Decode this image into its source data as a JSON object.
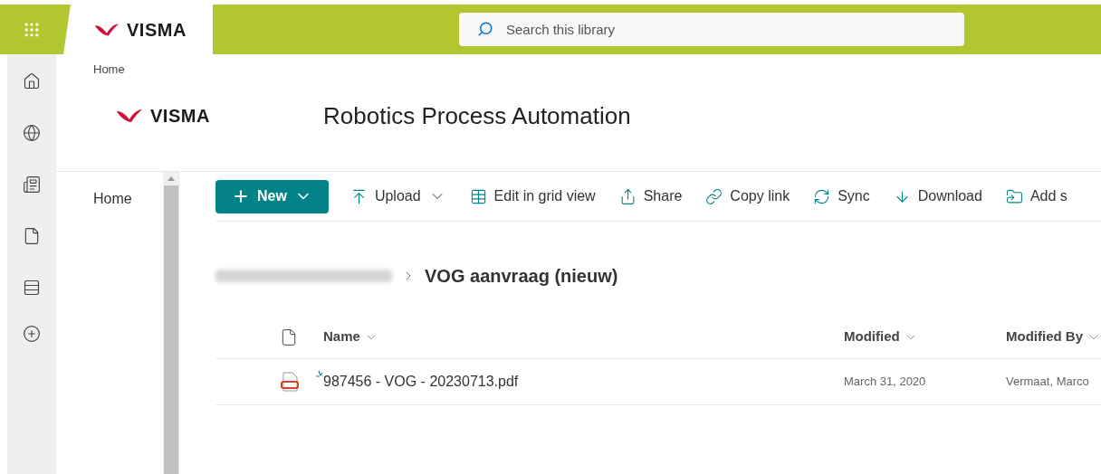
{
  "top_bar": {
    "logo": "VISMA",
    "search": {
      "placeholder": "Search this library"
    }
  },
  "header": {
    "breadcrumb": "Home",
    "logo": "VISMA",
    "title": "Robotics Process Automation"
  },
  "nav": {
    "items": [
      {
        "label": "Home",
        "selected": false
      }
    ]
  },
  "command_bar": [
    {
      "kind": "new",
      "label": "New",
      "has_menu": true
    },
    {
      "kind": "upload",
      "label": "Upload",
      "has_menu": true
    },
    {
      "kind": "grid",
      "label": "Edit in grid view",
      "has_menu": false
    },
    {
      "kind": "share",
      "label": "Share",
      "has_menu": false
    },
    {
      "kind": "link",
      "label": "Copy link",
      "has_menu": false
    },
    {
      "kind": "sync",
      "label": "Sync",
      "has_menu": false
    },
    {
      "kind": "download",
      "label": "Download",
      "has_menu": false
    },
    {
      "kind": "shortcut",
      "label": "Add s",
      "has_menu": false
    }
  ],
  "breadcrumb": {
    "current": "VOG aanvraag (nieuw)"
  },
  "table": {
    "columns": [
      "Name",
      "Modified",
      "Modified By"
    ],
    "rows": [
      {
        "name": "987456 - VOG - 20230713.pdf",
        "modified": "March 31, 2020",
        "modified_by": "Vermaat, Marco",
        "is_new": true
      }
    ]
  }
}
